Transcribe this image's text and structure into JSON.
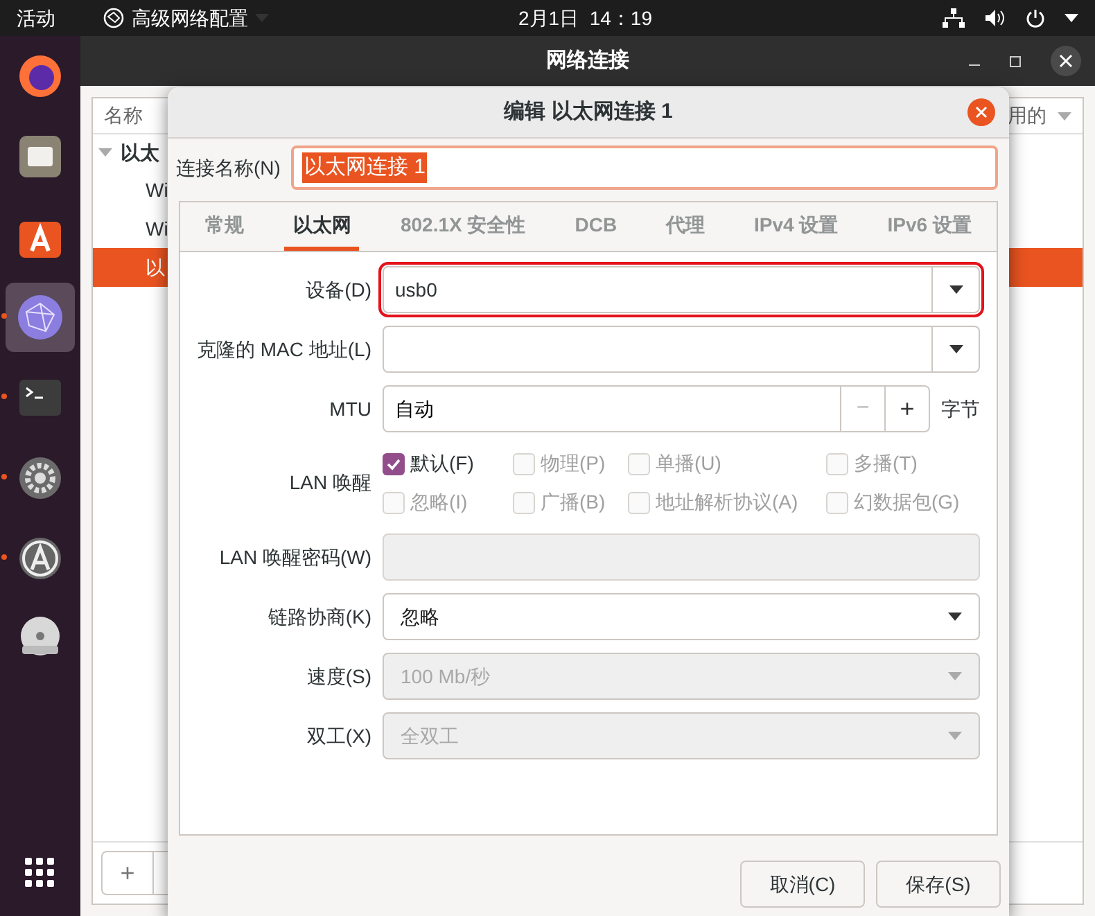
{
  "top_bar": {
    "activities": "活动",
    "app_menu": "高级网络配置",
    "clock": "2月1日  14：19"
  },
  "dock": [
    {
      "kind": "firefox",
      "running": false,
      "active": false
    },
    {
      "kind": "files",
      "running": false,
      "active": false
    },
    {
      "kind": "store",
      "running": false,
      "active": false
    },
    {
      "kind": "network",
      "running": true,
      "active": true
    },
    {
      "kind": "terminal",
      "running": true,
      "active": false
    },
    {
      "kind": "settings",
      "running": true,
      "active": false
    },
    {
      "kind": "updater",
      "running": true,
      "active": false
    },
    {
      "kind": "dvd",
      "running": false,
      "active": false
    },
    {
      "kind": "grid",
      "running": false,
      "active": false
    }
  ],
  "window": {
    "title": "网络连接",
    "list": {
      "column_1": "名称",
      "column_2": "用的",
      "rows": [
        {
          "label": "以太",
          "selected": false,
          "children": [
            {
              "label": "Wi",
              "selected": false
            },
            {
              "label": "Wi",
              "selected": false
            },
            {
              "label": "以",
              "selected": true
            }
          ]
        }
      ]
    },
    "add": "+"
  },
  "dialog": {
    "title": "编辑 以太网连接 1",
    "name_label": "连接名称(N)",
    "name_value": "以太网连接 1",
    "tabs": [
      {
        "label": "常规",
        "selected": false
      },
      {
        "label": "以太网",
        "selected": true
      },
      {
        "label": "802.1X 安全性",
        "selected": false
      },
      {
        "label": "DCB",
        "selected": false
      },
      {
        "label": "代理",
        "selected": false
      },
      {
        "label": "IPv4 设置",
        "selected": false
      },
      {
        "label": "IPv6 设置",
        "selected": false
      }
    ],
    "rows": [
      {
        "kind": "combo_entry",
        "label": "设备(D)",
        "value": "usb0",
        "highlighted": true
      },
      {
        "kind": "combo_entry",
        "label": "克隆的 MAC 地址(L)",
        "highlighted": false
      },
      {
        "kind": "spin",
        "label": "MTU",
        "value": "自动",
        "minus": "−",
        "plus": "+",
        "unit": "字节"
      },
      {
        "kind": "checks",
        "label": "LAN 唤醒",
        "options": [
          {
            "label": "默认(F)",
            "checked": true,
            "disabled": false
          },
          {
            "label": "物理(P)",
            "checked": false,
            "disabled": true
          },
          {
            "label": "单播(U)",
            "checked": false,
            "disabled": true
          },
          {
            "label": "多播(T)",
            "checked": false,
            "disabled": true
          },
          {
            "label": "忽略(I)",
            "checked": false,
            "disabled": true
          },
          {
            "label": "广播(B)",
            "checked": false,
            "disabled": true
          },
          {
            "label": "地址解析协议(A)",
            "checked": false,
            "disabled": true
          },
          {
            "label": "幻数据包(G)",
            "checked": false,
            "disabled": true
          }
        ]
      },
      {
        "kind": "entry",
        "label": "LAN 唤醒密码(W)",
        "disabled": true
      },
      {
        "kind": "combo",
        "label": "链路协商(K)",
        "value": "忽略",
        "disabled": false
      },
      {
        "kind": "combo",
        "label": "速度(S)",
        "value": "100 Mb/秒",
        "disabled": true
      },
      {
        "kind": "combo",
        "label": "双工(X)",
        "value": "全双工",
        "disabled": true
      }
    ],
    "buttons": [
      "取消(C)",
      "保存(S)"
    ]
  }
}
